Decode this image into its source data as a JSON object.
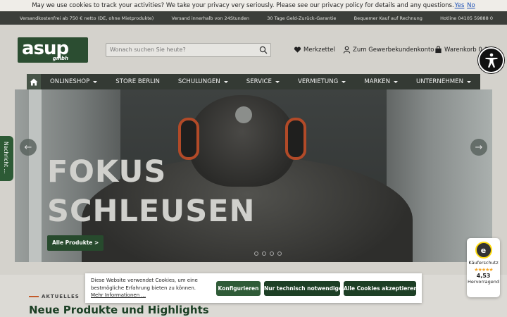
{
  "privacy": {
    "text": "May we use cookies to track your activities? We take your privacy very seriously. Please see our privacy policy for details and any questions.",
    "yes": "Yes",
    "no": "No"
  },
  "usps": [
    "Versandkostenfrei ab 750 € netto (DE, ohne Mietprodukte)",
    "Versand innerhalb von 24Stunden",
    "30 Tage Geld-Zurück-Garantie",
    "Bequemer Kauf auf Rechnung",
    "Hotline 04105 59888 0"
  ],
  "logo": {
    "main": "asup",
    "sub": "gmbh"
  },
  "search": {
    "placeholder": "Wonach suchen Sie heute?"
  },
  "header": {
    "wishlist": "Merkzettel",
    "account": "Zum Gewerbekundenkonto",
    "cart": "Warenkorb 0,0"
  },
  "nav": [
    {
      "label": "ONLINESHOP",
      "caret": true
    },
    {
      "label": "STORE BERLIN",
      "caret": false
    },
    {
      "label": "SCHULUNGEN",
      "caret": true
    },
    {
      "label": "SERVICE",
      "caret": true
    },
    {
      "label": "VERMIETUNG",
      "caret": true
    },
    {
      "label": "MARKEN",
      "caret": true
    },
    {
      "label": "UNTERNEHMEN",
      "caret": true
    }
  ],
  "hero": {
    "line1": "FOKUS",
    "line2": "SCHLEUSEN",
    "button": "Alle Produkte >",
    "slide_count": 4
  },
  "side_tab": "Nachricht ...",
  "section": {
    "eyebrow": "AKTUELLES",
    "title": "Neue Produkte und Highlights"
  },
  "cookie": {
    "text": "Diese Website verwendet Cookies, um eine bestmögliche Erfahrung bieten zu können.",
    "more": "Mehr Informationen ...",
    "configure": "Konfigurieren",
    "necessary": "Nur technisch notwendige",
    "accept_all": "Alle Cookies akzeptieren"
  },
  "trust": {
    "logo": "e",
    "label": "Käuferschutz",
    "stars": "★★★★★",
    "score": "4,53",
    "rating": "Hervorragend"
  },
  "colors": {
    "brand_green": "#2b4d31",
    "nav_dark": "#343a34",
    "accent_orange": "#c35a2a"
  }
}
